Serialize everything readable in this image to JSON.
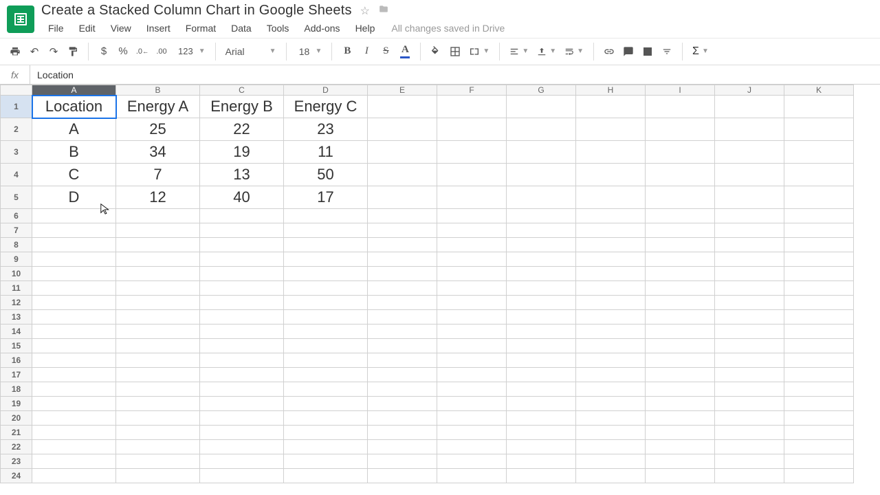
{
  "doc_title": "Create a Stacked Column Chart in Google Sheets",
  "menus": [
    "File",
    "Edit",
    "View",
    "Insert",
    "Format",
    "Data",
    "Tools",
    "Add-ons",
    "Help"
  ],
  "save_status": "All changes saved in Drive",
  "toolbar": {
    "font_name": "Arial",
    "font_size": "18",
    "number_format_label": "123"
  },
  "formula_bar": {
    "fx": "fx",
    "value": "Location"
  },
  "columns": [
    "A",
    "B",
    "C",
    "D",
    "E",
    "F",
    "G",
    "H",
    "I",
    "J",
    "K"
  ],
  "rows_shown": 24,
  "selected_col": "A",
  "selected_row": 1,
  "cells": {
    "A1": "Location",
    "B1": "Energy A",
    "C1": "Energy B",
    "D1": "Energy C",
    "A2": "A",
    "B2": "25",
    "C2": "22",
    "D2": "23",
    "A3": "B",
    "B3": "34",
    "C3": "19",
    "D3": "11",
    "A4": "C",
    "B4": "7",
    "C4": "13",
    "D4": "50",
    "A5": "D",
    "B5": "12",
    "C5": "40",
    "D5": "17"
  },
  "chart_data": {
    "type": "table",
    "title": "Create a Stacked Column Chart in Google Sheets",
    "columns": [
      "Location",
      "Energy A",
      "Energy B",
      "Energy C"
    ],
    "rows": [
      [
        "A",
        25,
        22,
        23
      ],
      [
        "B",
        34,
        19,
        11
      ],
      [
        "C",
        7,
        13,
        50
      ],
      [
        "D",
        12,
        40,
        17
      ]
    ]
  }
}
